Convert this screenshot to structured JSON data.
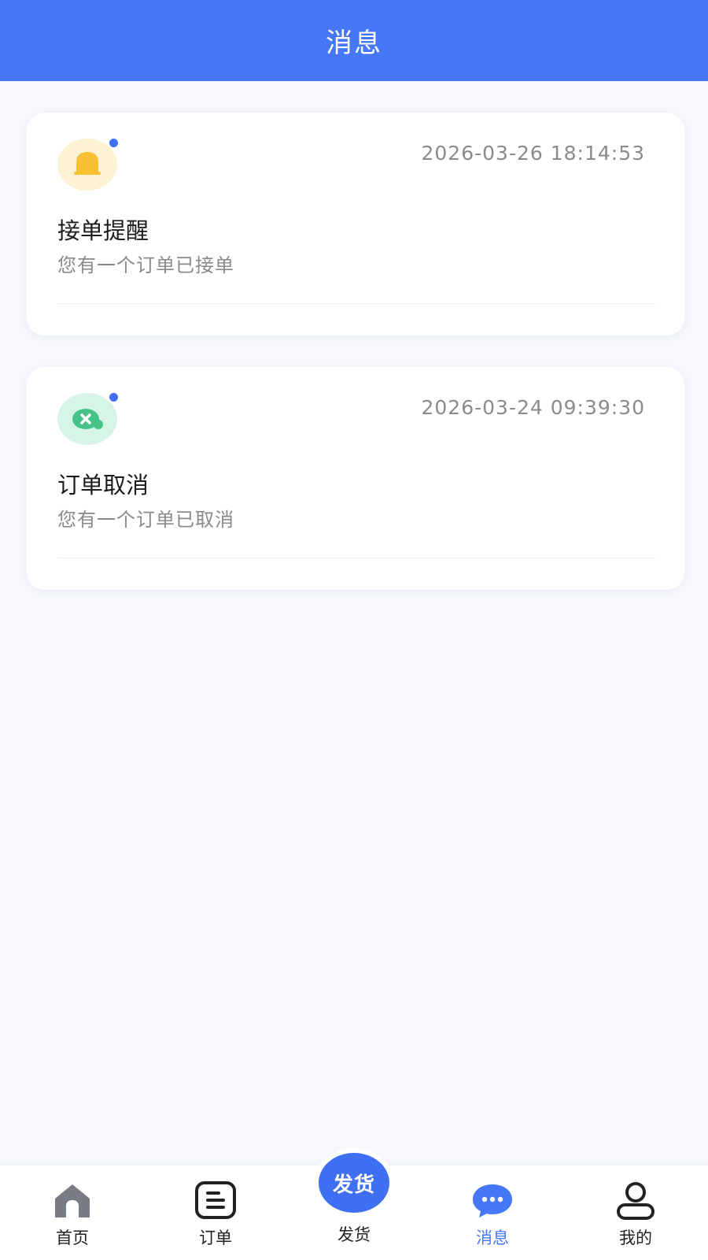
{
  "header": {
    "title": "消息"
  },
  "messages": [
    {
      "icon": "bell-icon",
      "time": "2026-03-26 18:14:53",
      "title": "接单提醒",
      "description": "您有一个订单已接单",
      "unread": true
    },
    {
      "icon": "cancel-bubble-icon",
      "time": "2026-03-24 09:39:30",
      "title": "订单取消",
      "description": "您有一个订单已取消",
      "unread": true
    }
  ],
  "tabbar": {
    "items": [
      {
        "label": "首页",
        "icon": "home-icon"
      },
      {
        "label": "订单",
        "icon": "order-list-icon"
      },
      {
        "label": "发货",
        "icon": "ship-button",
        "badge_text": "发货"
      },
      {
        "label": "消息",
        "icon": "message-bubble-icon",
        "active": true
      },
      {
        "label": "我的",
        "icon": "user-icon"
      }
    ]
  },
  "colors": {
    "primary": "#4677f6",
    "unread_dot": "#3f6ff3",
    "bell": "#f8c132",
    "cancel": "#47c387",
    "page_background": "#f6f8fd"
  }
}
